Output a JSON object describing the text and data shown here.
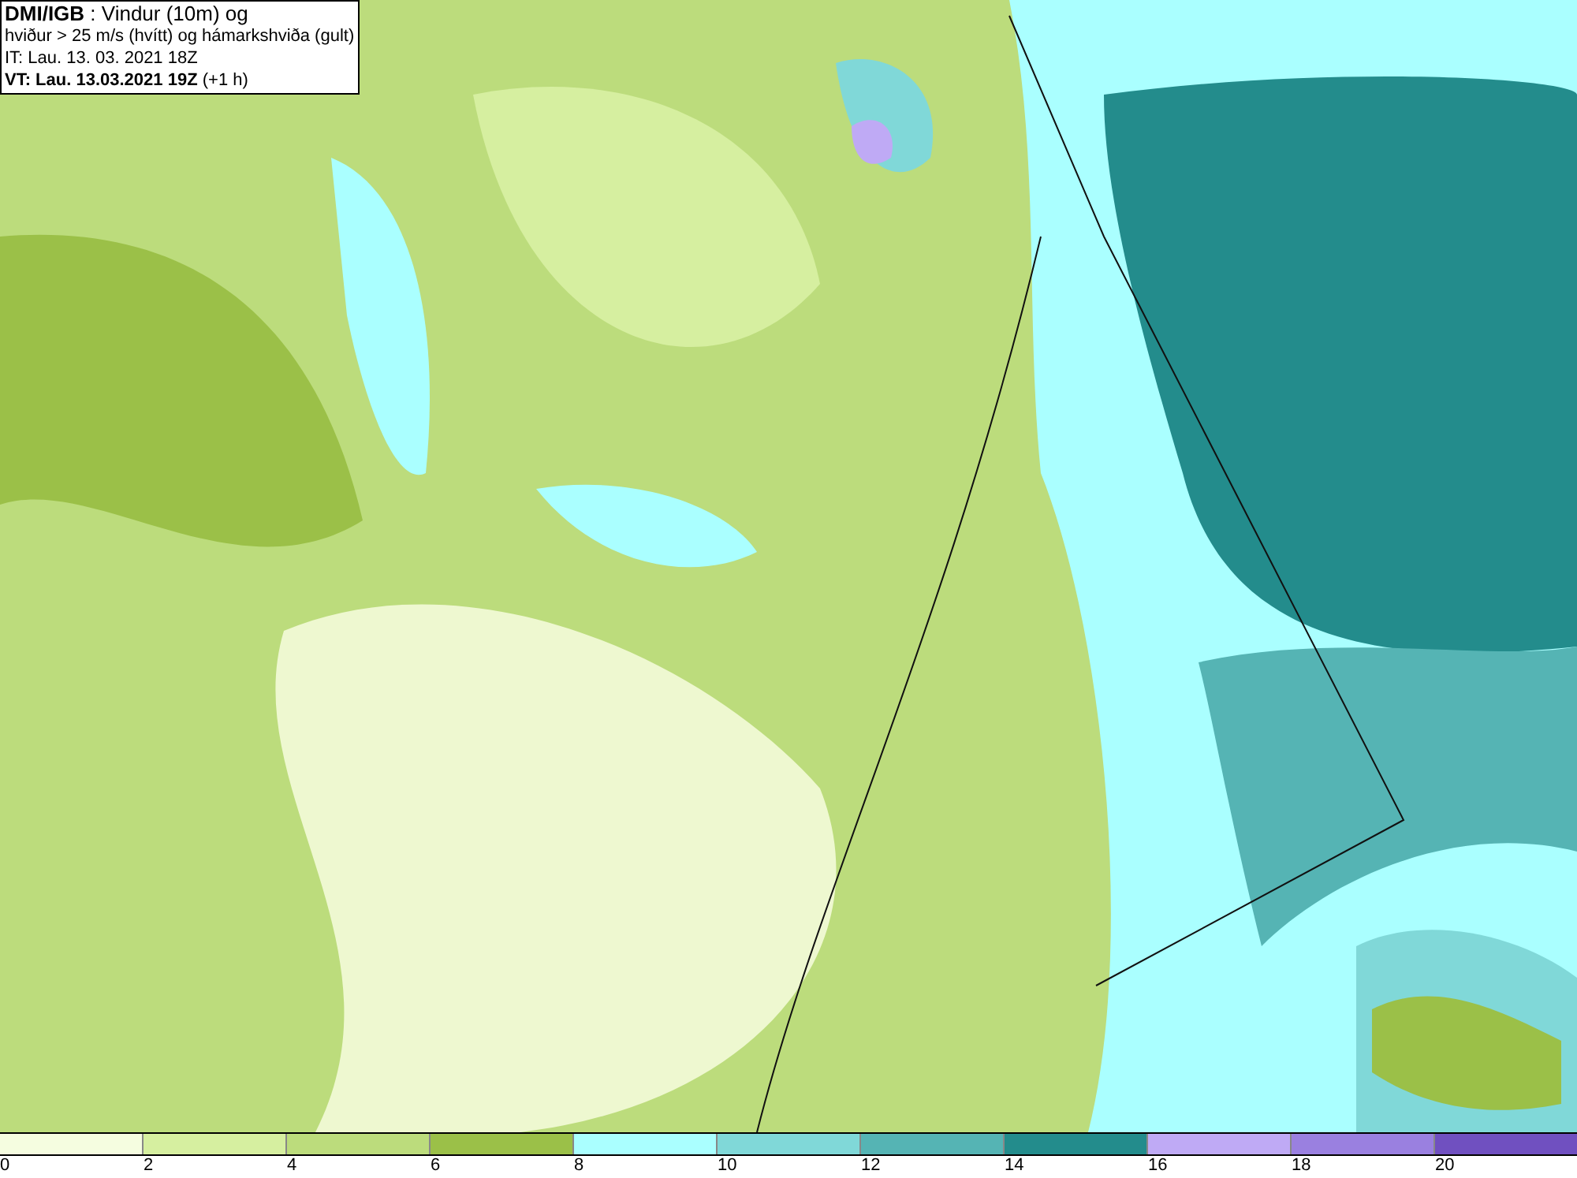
{
  "header": {
    "lines": [
      "**DMI/IGB** : Vindur (10m) og",
      "hviður > 25 m/s (hvítt) og hámarkshviða (gult)",
      "IT: Lau. 13. 03. 2021 18Z",
      "**VT: Lau. 13.03.2021 19Z** (+1 h)"
    ]
  },
  "legend": {
    "bins": [
      {
        "color": "#f5fde0"
      },
      {
        "color": "#d6efa0"
      },
      {
        "color": "#bcdc7c"
      },
      {
        "color": "#9bc048"
      },
      {
        "color": "#aaffff"
      },
      {
        "color": "#80d8d8"
      },
      {
        "color": "#55b4b4"
      },
      {
        "color": "#238c8c"
      },
      {
        "color": "#bfaaf5"
      },
      {
        "color": "#9a80e0"
      },
      {
        "color": "#7050c0"
      }
    ],
    "labels": [
      "0",
      "2",
      "4",
      "6",
      "8",
      "10",
      "12",
      "14",
      "16",
      "18",
      "20"
    ]
  }
}
